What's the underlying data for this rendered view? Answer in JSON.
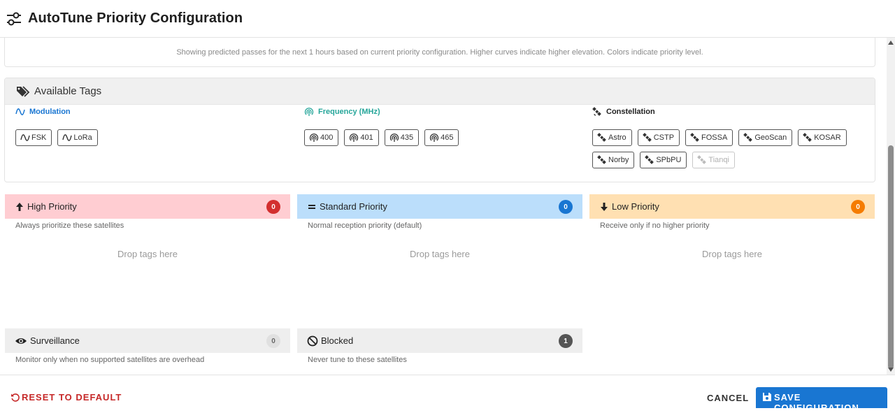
{
  "header": {
    "title": "AutoTune Priority Configuration",
    "icon": "tune-sliders-icon"
  },
  "info": {
    "text": "Showing predicted passes for the next 1 hours based on current priority configuration. Higher curves indicate higher elevation. Colors indicate priority level."
  },
  "tags": {
    "title": "Available Tags",
    "modulation": {
      "label": "Modulation",
      "color": "#1976d2",
      "items": [
        "FSK",
        "LoRa"
      ]
    },
    "frequency": {
      "label": "Frequency (MHz)",
      "color": "#26a69a",
      "items": [
        "400",
        "401",
        "435",
        "465"
      ]
    },
    "constellation": {
      "label": "Constellation",
      "color": "#222222",
      "items": [
        "Astro",
        "CSTP",
        "FOSSA",
        "GeoScan",
        "KOSAR",
        "Norby",
        "SPbPU",
        "Tianqi"
      ],
      "disabled": [
        "Tianqi"
      ]
    }
  },
  "priorities": {
    "high": {
      "name": "High Priority",
      "count": "0",
      "desc": "Always prioritize these satellites",
      "drop": "Drop tags here",
      "bg": "#ffcdd2",
      "badge": "#d32f2f"
    },
    "standard": {
      "name": "Standard Priority",
      "count": "0",
      "desc": "Normal reception priority (default)",
      "drop": "Drop tags here",
      "bg": "#bbdefb",
      "badge": "#1976d2"
    },
    "low": {
      "name": "Low Priority",
      "count": "0",
      "desc": "Receive only if no higher priority",
      "drop": "Drop tags here",
      "bg": "#ffe0b2",
      "badge": "#f57c00"
    },
    "surveillance": {
      "name": "Surveillance",
      "count": "0",
      "desc": "Monitor only when no supported satellites are overhead",
      "bg": "#eeeeee",
      "badge": "#e0e0e0"
    },
    "blocked": {
      "name": "Blocked",
      "count": "1",
      "desc": "Never tune to these satellites",
      "bg": "#eeeeee",
      "badge": "#555555"
    }
  },
  "footer": {
    "reset": "RESET TO DEFAULT",
    "cancel": "CANCEL",
    "save": "SAVE CONFIGURATION"
  }
}
